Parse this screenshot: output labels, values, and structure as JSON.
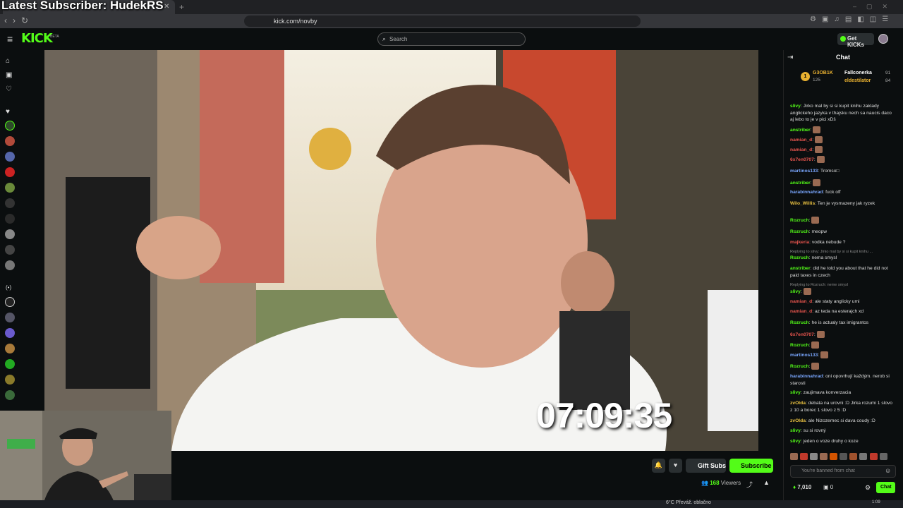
{
  "overlay": {
    "title": "Latest Subscriber: HudekRS"
  },
  "browser": {
    "tab_title": "",
    "url": "kick.com/novby"
  },
  "header": {
    "logo": "KICK",
    "logo_badge": "BETA",
    "search_placeholder": "Search",
    "get_kicks_label": "Get KICKs"
  },
  "stream": {
    "timer": "07:09:35",
    "viewers_count": "168",
    "viewers_label": "Viewers",
    "gift_subs_label": "Gift Subs",
    "subscribe_label": "Subscribe"
  },
  "chat": {
    "title": "Chat",
    "gifters": [
      {
        "rank": "1",
        "name": "G3OB1K",
        "count": "125"
      },
      {
        "rank": "",
        "name": "Fallconerka",
        "count": "91"
      },
      {
        "rank": "",
        "name": "eldestilator",
        "count": "84"
      }
    ],
    "messages": [
      {
        "user": "slivy",
        "color": "#53fc18",
        "text": "Jirko mal by si si kupit knihu zaklady anglickeho jazyka v thajsku nech sa naucis daco aj lebo to je v pici xDš"
      },
      {
        "user": "anstriber",
        "color": "#53fc18",
        "text": ""
      },
      {
        "user": "namian_d",
        "color": "#e8554e",
        "text": ""
      },
      {
        "user": "namian_d",
        "color": "#e8554e",
        "text": ""
      },
      {
        "user": "6x7en0707",
        "color": "#e8554e",
        "text": ""
      },
      {
        "user": "martinos133",
        "color": "#7aa7ff",
        "text": "Tromso□"
      },
      {
        "user": "anstriber",
        "color": "#53fc18",
        "text": ""
      },
      {
        "user": "harabinnahrad",
        "color": "#7aa7ff",
        "text": "fuck off"
      },
      {
        "user": "Wilo_Willis",
        "color": "#e8c040",
        "text": "Ten je vysmazeny jak ryzek"
      },
      {
        "user": "Rozruch",
        "color": "#53fc18",
        "text": ""
      },
      {
        "user": "Rozruch",
        "color": "#53fc18",
        "text": "meopw"
      },
      {
        "user": "majkeria",
        "color": "#e8554e",
        "text": "vodka nebude ?"
      },
      {
        "user": "",
        "color": "#888",
        "text": "Replying to slivy: Jirko mal by si si kupit knihu ..."
      },
      {
        "user": "Rozruch",
        "color": "#53fc18",
        "text": "nema smysl"
      },
      {
        "user": "anstriber",
        "color": "#53fc18",
        "text": "did he told you about that he did not paid taxes in czech"
      },
      {
        "user": "",
        "color": "#888",
        "text": "Replying to Rozruch: neme smysl"
      },
      {
        "user": "slivy",
        "color": "#53fc18",
        "text": ""
      },
      {
        "user": "namian_d",
        "color": "#e8554e",
        "text": "ale staty anglicky umi"
      },
      {
        "user": "namian_d",
        "color": "#e8554e",
        "text": "az teda na esterajch xd"
      },
      {
        "user": "Rozruch",
        "color": "#53fc18",
        "text": "he is actualy tax imigrantos"
      },
      {
        "user": "6x7en0707",
        "color": "#e8554e",
        "text": ""
      },
      {
        "user": "Rozruch",
        "color": "#53fc18",
        "text": ""
      },
      {
        "user": "martinos133",
        "color": "#7aa7ff",
        "text": ""
      },
      {
        "user": "Rozruch",
        "color": "#53fc18",
        "text": ""
      },
      {
        "user": "harabinnahrad",
        "color": "#7aa7ff",
        "text": "oni opovrhují každým. nerob si starosti"
      },
      {
        "user": "slivy",
        "color": "#53fc18",
        "text": "zaujimava konverzacia"
      },
      {
        "user": "zvOlda",
        "color": "#e8c040",
        "text": "debata na urovni :D Jirka rozumi 1 slovo z 10 a borec 1 slovo z 5 :D"
      },
      {
        "user": "zvOlda",
        "color": "#e8c040",
        "text": "ale Nizozemec si dava coudy :D"
      },
      {
        "user": "slivy",
        "color": "#53fc18",
        "text": "su si rovný"
      },
      {
        "user": "slivy",
        "color": "#53fc18",
        "text": "jeden o voze druhy o koze"
      }
    ],
    "input_placeholder": "You're banned from chat",
    "kicks_balance": "7,010",
    "points": "0",
    "chat_button": "Chat"
  },
  "taskbar": {
    "weather": "6°C  Převáž. oblačno",
    "time": "1:09"
  },
  "colors": {
    "accent": "#53fc18",
    "bg": "#0b0e0f"
  }
}
